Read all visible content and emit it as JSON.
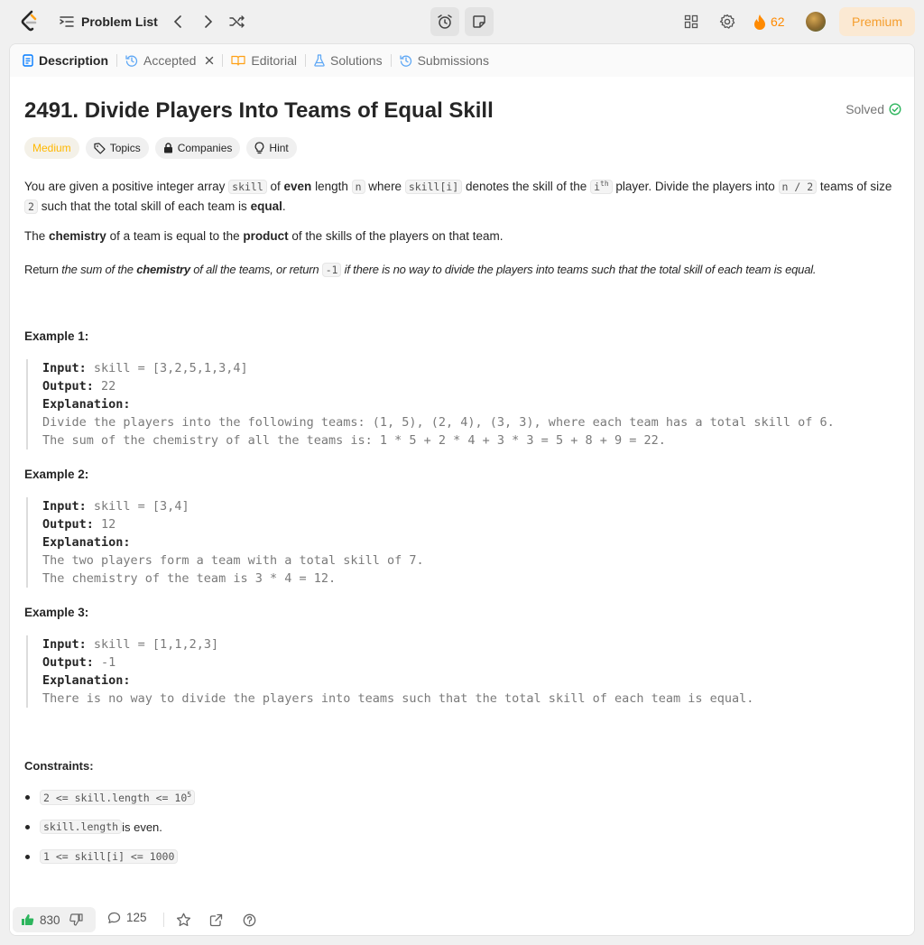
{
  "topnav": {
    "problem_list_label": "Problem List",
    "streak_count": "62",
    "premium_label": "Premium"
  },
  "tabs": {
    "description": "Description",
    "accepted": "Accepted",
    "editorial": "Editorial",
    "solutions": "Solutions",
    "submissions": "Submissions"
  },
  "problem": {
    "title": "2491. Divide Players Into Teams of Equal Skill",
    "status": "Solved",
    "difficulty": "Medium",
    "tags": {
      "topics": "Topics",
      "companies": "Companies",
      "hint": "Hint"
    },
    "p1": {
      "t1": "You are given a positive integer array ",
      "c1": "skill",
      "t2": " of ",
      "b1": "even",
      "t3": " length ",
      "c2": "n",
      "t4": " where ",
      "c3": "skill[i]",
      "t5": " denotes the skill of the ",
      "c4": "i",
      "c4sup": "th",
      "t6": " player. Divide the players into ",
      "c5": "n / 2",
      "t7": " teams of size ",
      "c6": "2",
      "t8": " such that the total skill of each team is ",
      "b2": "equal",
      "t9": "."
    },
    "p2": {
      "t1": "The ",
      "b1": "chemistry",
      "t2": " of a team is equal to the ",
      "b2": "product",
      "t3": " of the skills of the players on that team."
    },
    "p3": {
      "t1": "Return ",
      "i1": "the sum of the ",
      "b1": "chemistry",
      "i2": " of all the teams, or return ",
      "c1": "-1",
      "i3": " if there is no way to divide the players into teams such that the total skill of each team is equal."
    },
    "examples": [
      {
        "title": "Example 1:",
        "input_label": "Input:",
        "input": " skill = [3,2,5,1,3,4]",
        "output_label": "Output:",
        "output": " 22",
        "explanation_label": "Explanation:",
        "explanation": "Divide the players into the following teams: (1, 5), (2, 4), (3, 3), where each team has a total skill of 6.\nThe sum of the chemistry of all the teams is: 1 * 5 + 2 * 4 + 3 * 3 = 5 + 8 + 9 = 22."
      },
      {
        "title": "Example 2:",
        "input_label": "Input:",
        "input": " skill = [3,4]",
        "output_label": "Output:",
        "output": " 12",
        "explanation_label": "Explanation:",
        "explanation": "The two players form a team with a total skill of 7.\nThe chemistry of the team is 3 * 4 = 12."
      },
      {
        "title": "Example 3:",
        "input_label": "Input:",
        "input": " skill = [1,1,2,3]",
        "output_label": "Output:",
        "output": " -1",
        "explanation_label": "Explanation:",
        "explanation": "There is no way to divide the players into teams such that the total skill of each team is equal."
      }
    ],
    "constraints_title": "Constraints:",
    "constraints": {
      "c1_code": "2 <= skill.length <= 10",
      "c1_sup": "5",
      "c2_code": "skill.length",
      "c2_text": " is even.",
      "c3_code": "1 <= skill[i] <= 1000"
    }
  },
  "bottombar": {
    "likes": "830",
    "comments": "125"
  },
  "colors": {
    "accent_orange": "#ffa116",
    "medium": "#ffb800",
    "solved_green": "#2db55d",
    "like_green": "#2db55d",
    "premium_bg": "#fbe9d3"
  }
}
